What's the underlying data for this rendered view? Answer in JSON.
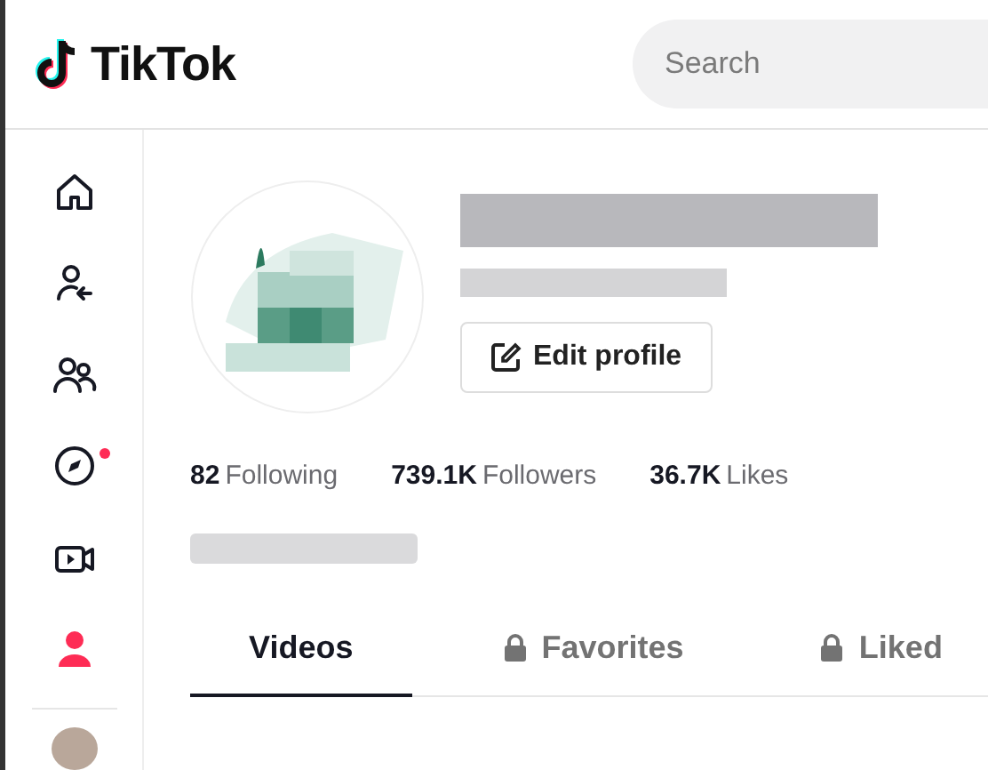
{
  "header": {
    "logo": "TikTok",
    "search": {
      "placeholder": "Search"
    }
  },
  "sidebar": {
    "items": [
      {
        "kind": "home",
        "selected": false,
        "dot": false
      },
      {
        "kind": "following",
        "selected": false,
        "dot": false
      },
      {
        "kind": "friends",
        "selected": false,
        "dot": false
      },
      {
        "kind": "explore",
        "selected": false,
        "dot": true
      },
      {
        "kind": "live",
        "selected": false,
        "dot": false
      },
      {
        "kind": "profile",
        "selected": true,
        "dot": false
      }
    ]
  },
  "profile": {
    "edit_button": "Edit profile",
    "stats": [
      {
        "value": "82",
        "label": "Following"
      },
      {
        "value": "739.1K",
        "label": "Followers"
      },
      {
        "value": "36.7K",
        "label": "Likes"
      }
    ]
  },
  "tabs": [
    {
      "label": "Videos",
      "selected": true,
      "locked": false
    },
    {
      "label": "Favorites",
      "selected": false,
      "locked": true
    },
    {
      "label": "Liked",
      "selected": false,
      "locked": true
    }
  ]
}
